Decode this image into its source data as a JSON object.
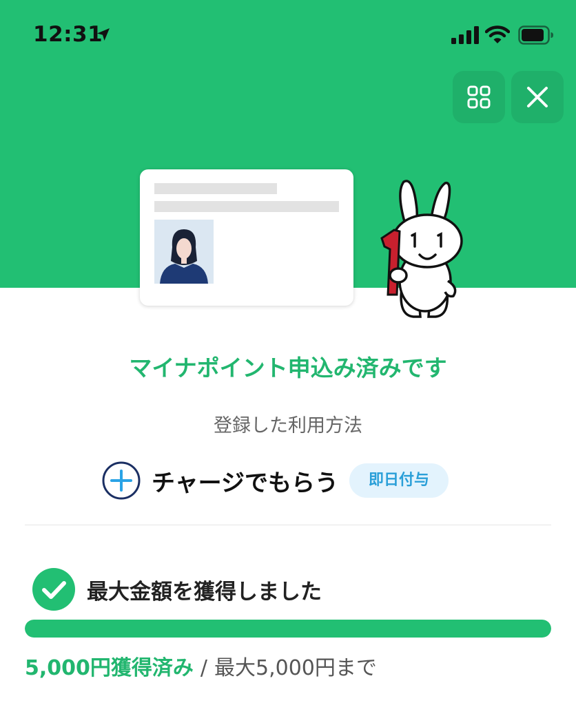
{
  "status_bar": {
    "time": "12:31",
    "icons": [
      "location-arrow-icon",
      "cellular-signal-icon",
      "wifi-icon",
      "battery-icon"
    ]
  },
  "header": {
    "buttons": [
      "grid-menu-icon",
      "close-icon"
    ]
  },
  "colors": {
    "brand_green": "#22bf73",
    "title_green": "#22b66f",
    "badge_bg": "#e3f3fd",
    "badge_text": "#2a9fd8",
    "plus_circle": "#1b2f63"
  },
  "status": {
    "title": "マイナポイント申込み済みです"
  },
  "method": {
    "caption": "登録した利用方法",
    "label": "チャージでもらう",
    "badge": "即日付与",
    "icon": "plus-circle-icon"
  },
  "result": {
    "label": "最大金額を獲得しました",
    "icon": "check-circle-icon",
    "progress_percent": 100,
    "earned": "5,000円獲得済み",
    "separator": "/",
    "max": "最大5,000円まで"
  }
}
